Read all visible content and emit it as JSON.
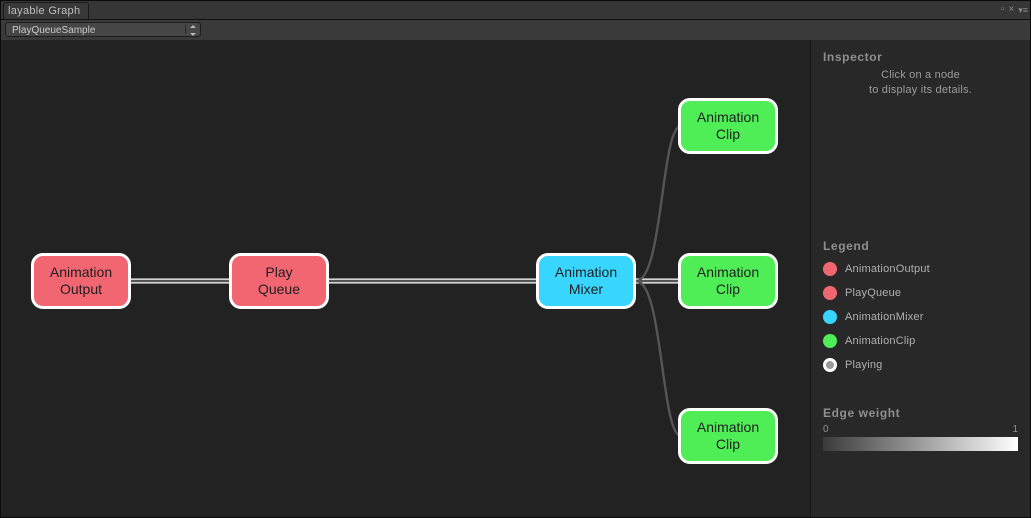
{
  "window": {
    "title": "layable Graph"
  },
  "toolbar": {
    "dropdown_value": "PlayQueueSample"
  },
  "graph": {
    "nodes": {
      "output": {
        "label": "Animation\nOutput"
      },
      "queue": {
        "label": "Play\nQueue"
      },
      "mixer": {
        "label": "Animation\nMixer"
      },
      "clip_a": {
        "label": "Animation\nClip"
      },
      "clip_b": {
        "label": "Animation\nClip"
      },
      "clip_c": {
        "label": "Animation\nClip"
      }
    }
  },
  "inspector": {
    "title": "Inspector",
    "hint_line1": "Click on a node",
    "hint_line2": "to display its details."
  },
  "legend": {
    "title": "Legend",
    "items": {
      "output": "AnimationOutput",
      "queue": "PlayQueue",
      "mixer": "AnimationMixer",
      "clip": "AnimationClip",
      "playing": "Playing"
    }
  },
  "edge_weight": {
    "title": "Edge weight",
    "min": "0",
    "max": "1"
  }
}
